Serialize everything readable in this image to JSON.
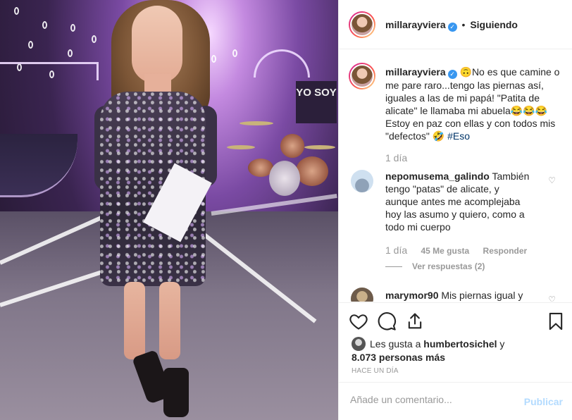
{
  "header": {
    "username": "millarayviera",
    "separator": "•",
    "follow_status": "Siguiendo",
    "more_icon": "more-options-icon"
  },
  "caption": {
    "username": "millarayviera",
    "text": "🙃No es que camine o me pare raro...tengo las piernas así, iguales a las de mi papá! \"Patita de alicate\" le llamaba mi abuela😂😂😂 Estoy en paz con ellas y con todos mis \"defectos\" 🤣",
    "hashtag": "#Eso",
    "time": "1 día"
  },
  "comments": [
    {
      "username": "nepomusema_galindo",
      "text": "También tengo \"patas\" de alicate, y aunque antes me acomplejaba hoy las asumo y quiero, como a todo mi cuerpo",
      "time": "1 día",
      "likes": "45 Me gusta",
      "reply_label": "Responder",
      "view_replies": "Ver respuestas (2)"
    },
    {
      "username": "marymor90",
      "text": "Mis piernas igual y"
    }
  ],
  "actions": {
    "like_icon": "heart-icon",
    "comment_icon": "comment-icon",
    "share_icon": "share-icon",
    "save_icon": "bookmark-icon"
  },
  "likes": {
    "prefix": "Les gusta a",
    "user": "humbertosichel",
    "conj": "y",
    "others": "8.073 personas más"
  },
  "timestamp": "HACE UN DÍA",
  "add_comment": {
    "placeholder": "Añade un comentario...",
    "publish": "Publicar"
  },
  "photo_sign": "YO SOY",
  "colors": {
    "link": "#003569",
    "verified": "#3897f0",
    "publish_disabled": "#b3dbff",
    "muted": "#999999"
  }
}
